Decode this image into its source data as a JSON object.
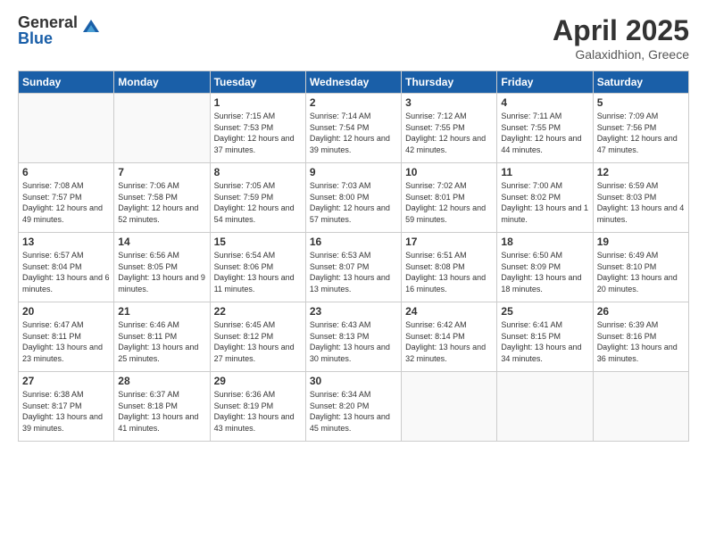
{
  "header": {
    "logo_general": "General",
    "logo_blue": "Blue",
    "title": "April 2025",
    "location": "Galaxidhion, Greece"
  },
  "days_of_week": [
    "Sunday",
    "Monday",
    "Tuesday",
    "Wednesday",
    "Thursday",
    "Friday",
    "Saturday"
  ],
  "weeks": [
    [
      {
        "day": "",
        "info": ""
      },
      {
        "day": "",
        "info": ""
      },
      {
        "day": "1",
        "info": "Sunrise: 7:15 AM\nSunset: 7:53 PM\nDaylight: 12 hours and 37 minutes."
      },
      {
        "day": "2",
        "info": "Sunrise: 7:14 AM\nSunset: 7:54 PM\nDaylight: 12 hours and 39 minutes."
      },
      {
        "day": "3",
        "info": "Sunrise: 7:12 AM\nSunset: 7:55 PM\nDaylight: 12 hours and 42 minutes."
      },
      {
        "day": "4",
        "info": "Sunrise: 7:11 AM\nSunset: 7:55 PM\nDaylight: 12 hours and 44 minutes."
      },
      {
        "day": "5",
        "info": "Sunrise: 7:09 AM\nSunset: 7:56 PM\nDaylight: 12 hours and 47 minutes."
      }
    ],
    [
      {
        "day": "6",
        "info": "Sunrise: 7:08 AM\nSunset: 7:57 PM\nDaylight: 12 hours and 49 minutes."
      },
      {
        "day": "7",
        "info": "Sunrise: 7:06 AM\nSunset: 7:58 PM\nDaylight: 12 hours and 52 minutes."
      },
      {
        "day": "8",
        "info": "Sunrise: 7:05 AM\nSunset: 7:59 PM\nDaylight: 12 hours and 54 minutes."
      },
      {
        "day": "9",
        "info": "Sunrise: 7:03 AM\nSunset: 8:00 PM\nDaylight: 12 hours and 57 minutes."
      },
      {
        "day": "10",
        "info": "Sunrise: 7:02 AM\nSunset: 8:01 PM\nDaylight: 12 hours and 59 minutes."
      },
      {
        "day": "11",
        "info": "Sunrise: 7:00 AM\nSunset: 8:02 PM\nDaylight: 13 hours and 1 minute."
      },
      {
        "day": "12",
        "info": "Sunrise: 6:59 AM\nSunset: 8:03 PM\nDaylight: 13 hours and 4 minutes."
      }
    ],
    [
      {
        "day": "13",
        "info": "Sunrise: 6:57 AM\nSunset: 8:04 PM\nDaylight: 13 hours and 6 minutes."
      },
      {
        "day": "14",
        "info": "Sunrise: 6:56 AM\nSunset: 8:05 PM\nDaylight: 13 hours and 9 minutes."
      },
      {
        "day": "15",
        "info": "Sunrise: 6:54 AM\nSunset: 8:06 PM\nDaylight: 13 hours and 11 minutes."
      },
      {
        "day": "16",
        "info": "Sunrise: 6:53 AM\nSunset: 8:07 PM\nDaylight: 13 hours and 13 minutes."
      },
      {
        "day": "17",
        "info": "Sunrise: 6:51 AM\nSunset: 8:08 PM\nDaylight: 13 hours and 16 minutes."
      },
      {
        "day": "18",
        "info": "Sunrise: 6:50 AM\nSunset: 8:09 PM\nDaylight: 13 hours and 18 minutes."
      },
      {
        "day": "19",
        "info": "Sunrise: 6:49 AM\nSunset: 8:10 PM\nDaylight: 13 hours and 20 minutes."
      }
    ],
    [
      {
        "day": "20",
        "info": "Sunrise: 6:47 AM\nSunset: 8:11 PM\nDaylight: 13 hours and 23 minutes."
      },
      {
        "day": "21",
        "info": "Sunrise: 6:46 AM\nSunset: 8:11 PM\nDaylight: 13 hours and 25 minutes."
      },
      {
        "day": "22",
        "info": "Sunrise: 6:45 AM\nSunset: 8:12 PM\nDaylight: 13 hours and 27 minutes."
      },
      {
        "day": "23",
        "info": "Sunrise: 6:43 AM\nSunset: 8:13 PM\nDaylight: 13 hours and 30 minutes."
      },
      {
        "day": "24",
        "info": "Sunrise: 6:42 AM\nSunset: 8:14 PM\nDaylight: 13 hours and 32 minutes."
      },
      {
        "day": "25",
        "info": "Sunrise: 6:41 AM\nSunset: 8:15 PM\nDaylight: 13 hours and 34 minutes."
      },
      {
        "day": "26",
        "info": "Sunrise: 6:39 AM\nSunset: 8:16 PM\nDaylight: 13 hours and 36 minutes."
      }
    ],
    [
      {
        "day": "27",
        "info": "Sunrise: 6:38 AM\nSunset: 8:17 PM\nDaylight: 13 hours and 39 minutes."
      },
      {
        "day": "28",
        "info": "Sunrise: 6:37 AM\nSunset: 8:18 PM\nDaylight: 13 hours and 41 minutes."
      },
      {
        "day": "29",
        "info": "Sunrise: 6:36 AM\nSunset: 8:19 PM\nDaylight: 13 hours and 43 minutes."
      },
      {
        "day": "30",
        "info": "Sunrise: 6:34 AM\nSunset: 8:20 PM\nDaylight: 13 hours and 45 minutes."
      },
      {
        "day": "",
        "info": ""
      },
      {
        "day": "",
        "info": ""
      },
      {
        "day": "",
        "info": ""
      }
    ]
  ]
}
